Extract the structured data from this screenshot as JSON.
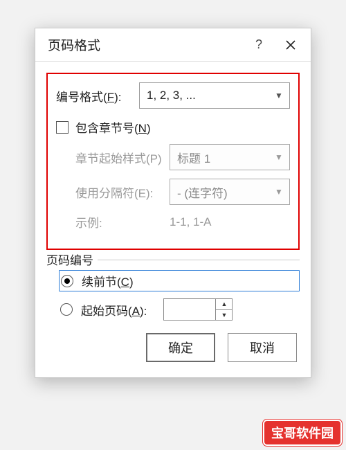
{
  "titlebar": {
    "title": "页码格式"
  },
  "format": {
    "label_pre": "编号格式(",
    "label_key": "F",
    "label_post": "):",
    "selected": "1, 2, 3, ..."
  },
  "chapter": {
    "checkbox_pre": "包含章节号(",
    "checkbox_key": "N",
    "checkbox_post": ")",
    "start_style_label": "章节起始样式(P)",
    "start_style_value": "标题 1",
    "separator_label": "使用分隔符(E):",
    "separator_value": "-  (连字符)",
    "example_label": "示例:",
    "example_value": "1-1, 1-A"
  },
  "numbering": {
    "group_label": "页码编号",
    "continue_pre": "续前节(",
    "continue_key": "C",
    "continue_post": ")",
    "start_at_pre": "起始页码(",
    "start_at_key": "A",
    "start_at_post": "):",
    "start_at_value": ""
  },
  "buttons": {
    "ok": "确定",
    "cancel": "取消"
  },
  "watermark": "宝哥软件园"
}
